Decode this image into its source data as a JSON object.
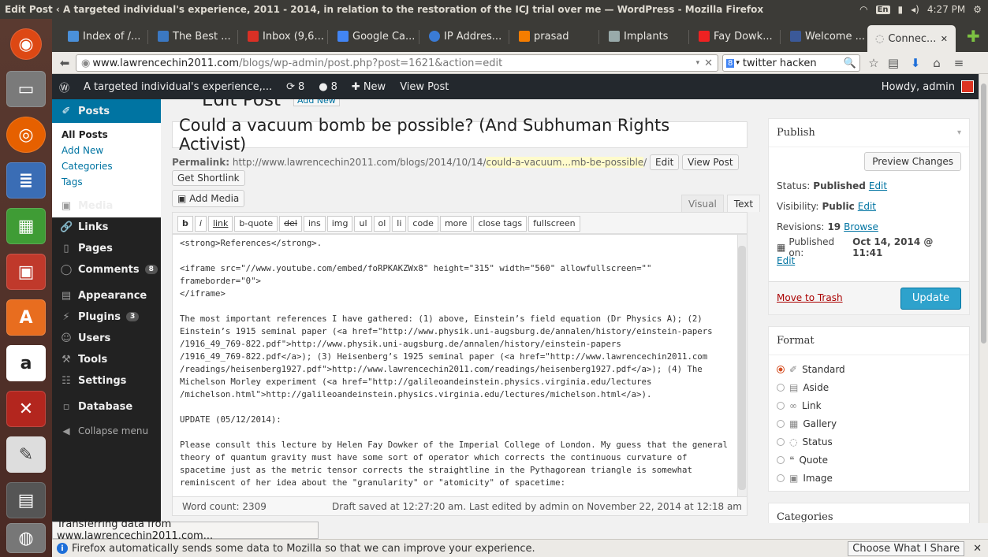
{
  "window": {
    "title": "Edit Post ‹ A targeted individual's experience, 2011 - 2014, in relation to the restoration of the ICJ trial over me — WordPress - Mozilla Firefox",
    "lang": "En",
    "time": "4:27 PM"
  },
  "tabs": [
    {
      "label": "Index of /...",
      "color": "#4a90d9"
    },
    {
      "label": "The Best ...",
      "color": "#3b78c2"
    },
    {
      "label": "Inbox (9,6...",
      "color": "#d93025"
    },
    {
      "label": "Google Ca...",
      "color": "#4285f4"
    },
    {
      "label": "IP Addres...",
      "color": "#3a7bd5"
    },
    {
      "label": "prasad",
      "color": "#f57d00"
    },
    {
      "label": "Implants",
      "color": "#9aa"
    },
    {
      "label": "Fay Dowk...",
      "color": "#e22"
    },
    {
      "label": "Welcome ...",
      "color": "#3b5998"
    },
    {
      "label": "Connec...",
      "color": "#888"
    }
  ],
  "nav": {
    "url_host": "www.lawrencechin2011.com",
    "url_path": "/blogs/wp-admin/post.php?post=1621&action=edit",
    "search_value": "twitter hacken"
  },
  "adminbar": {
    "site": "A targeted individual's experience,...",
    "updates": "8",
    "comments": "8",
    "new": "New",
    "view_post": "View Post",
    "howdy": "Howdy, admin"
  },
  "menu": {
    "posts": "Posts",
    "sub": [
      "All Posts",
      "Add New",
      "Categories",
      "Tags"
    ],
    "media": "Media",
    "links": "Links",
    "pages": "Pages",
    "comments": "Comments",
    "comments_count": "8",
    "appearance": "Appearance",
    "plugins": "Plugins",
    "plugins_count": "3",
    "users": "Users",
    "tools": "Tools",
    "settings": "Settings",
    "database": "Database",
    "collapse": "Collapse menu"
  },
  "editor": {
    "page_title": "Edit Post",
    "add_new": "Add New",
    "post_title": "Could a vacuum bomb be possible? (And Subhuman Rights Activist)",
    "permalink_label": "Permalink:",
    "permalink_base": "http://www.lawrencechin2011.com/blogs/2014/10/14/",
    "permalink_slug": "could-a-vacuum...mb-be-possible",
    "permalink_tail": "/",
    "edit_btn": "Edit",
    "view_post_btn": "View Post",
    "shortlink_btn": "Get Shortlink",
    "add_media": "Add Media",
    "tab_visual": "Visual",
    "tab_text": "Text",
    "quicktags": [
      "b",
      "i",
      "link",
      "b-quote",
      "del",
      "ins",
      "img",
      "ul",
      "ol",
      "li",
      "code",
      "more",
      "close tags",
      "fullscreen"
    ],
    "content": "<strong>References</strong>.\n\n<iframe src=\"//www.youtube.com/embed/foRPKAKZWx8\" height=\"315\" width=\"560\" allowfullscreen=\"\" frameborder=\"0\">\n</iframe>\n\nThe most important references I have gathered: (1) above, Einstein’s field equation (Dr Physics A); (2)\nEinstein’s 1915 seminal paper (<a href=\"http://www.physik.uni-augsburg.de/annalen/history/einstein-papers\n/1916_49_769-822.pdf\">http://www.physik.uni-augsburg.de/annalen/history/einstein-papers\n/1916_49_769-822.pdf</a>); (3) Heisenberg’s 1925 seminal paper (<a href=\"http://www.lawrencechin2011.com\n/readings/heisenberg1927.pdf\">http://www.lawrencechin2011.com/readings/heisenberg1927.pdf</a>); (4) The\nMichelson Morley experiment (<a href=\"http://galileoandeinstein.physics.virginia.edu/lectures\n/michelson.html\">http://galileoandeinstein.physics.virginia.edu/lectures/michelson.html</a>).\n\nUPDATE (05/12/2014):\n\nPlease consult this lecture by Helen Fay Dowker of the Imperial College of London. My guess that the general\ntheory of quantum gravity must have some sort of operator which corrects the continuous curvature of\nspacetime just as the metric tensor corrects the straightline in the Pythagorean triangle is somewhat\nreminiscent of her idea about the \"granularity\" or \"atomicity\" of spacetime:",
    "word_count": "Word count: 2309",
    "draft_status": "Draft saved at 12:27:20 am. Last edited by admin on November 22, 2014 at 12:18 am"
  },
  "publish": {
    "heading": "Publish",
    "preview": "Preview Changes",
    "status_label": "Status:",
    "status_value": "Published",
    "visibility_label": "Visibility:",
    "visibility_value": "Public",
    "revisions_label": "Revisions:",
    "revisions_value": "19",
    "browse": "Browse",
    "published_label": "Published on:",
    "published_value": "Oct 14, 2014 @ 11:41",
    "edit": "Edit",
    "trash": "Move to Trash",
    "update": "Update"
  },
  "format": {
    "heading": "Format",
    "options": [
      "Standard",
      "Aside",
      "Link",
      "Gallery",
      "Status",
      "Quote",
      "Image"
    ]
  },
  "categories": {
    "heading": "Categories"
  },
  "statusbar": {
    "transfer": "Transferring data from www.lawrencechin2011.com...",
    "notice": "Firefox automatically sends some data to Mozilla so that we can improve your experience.",
    "choose": "Choose What I Share"
  }
}
